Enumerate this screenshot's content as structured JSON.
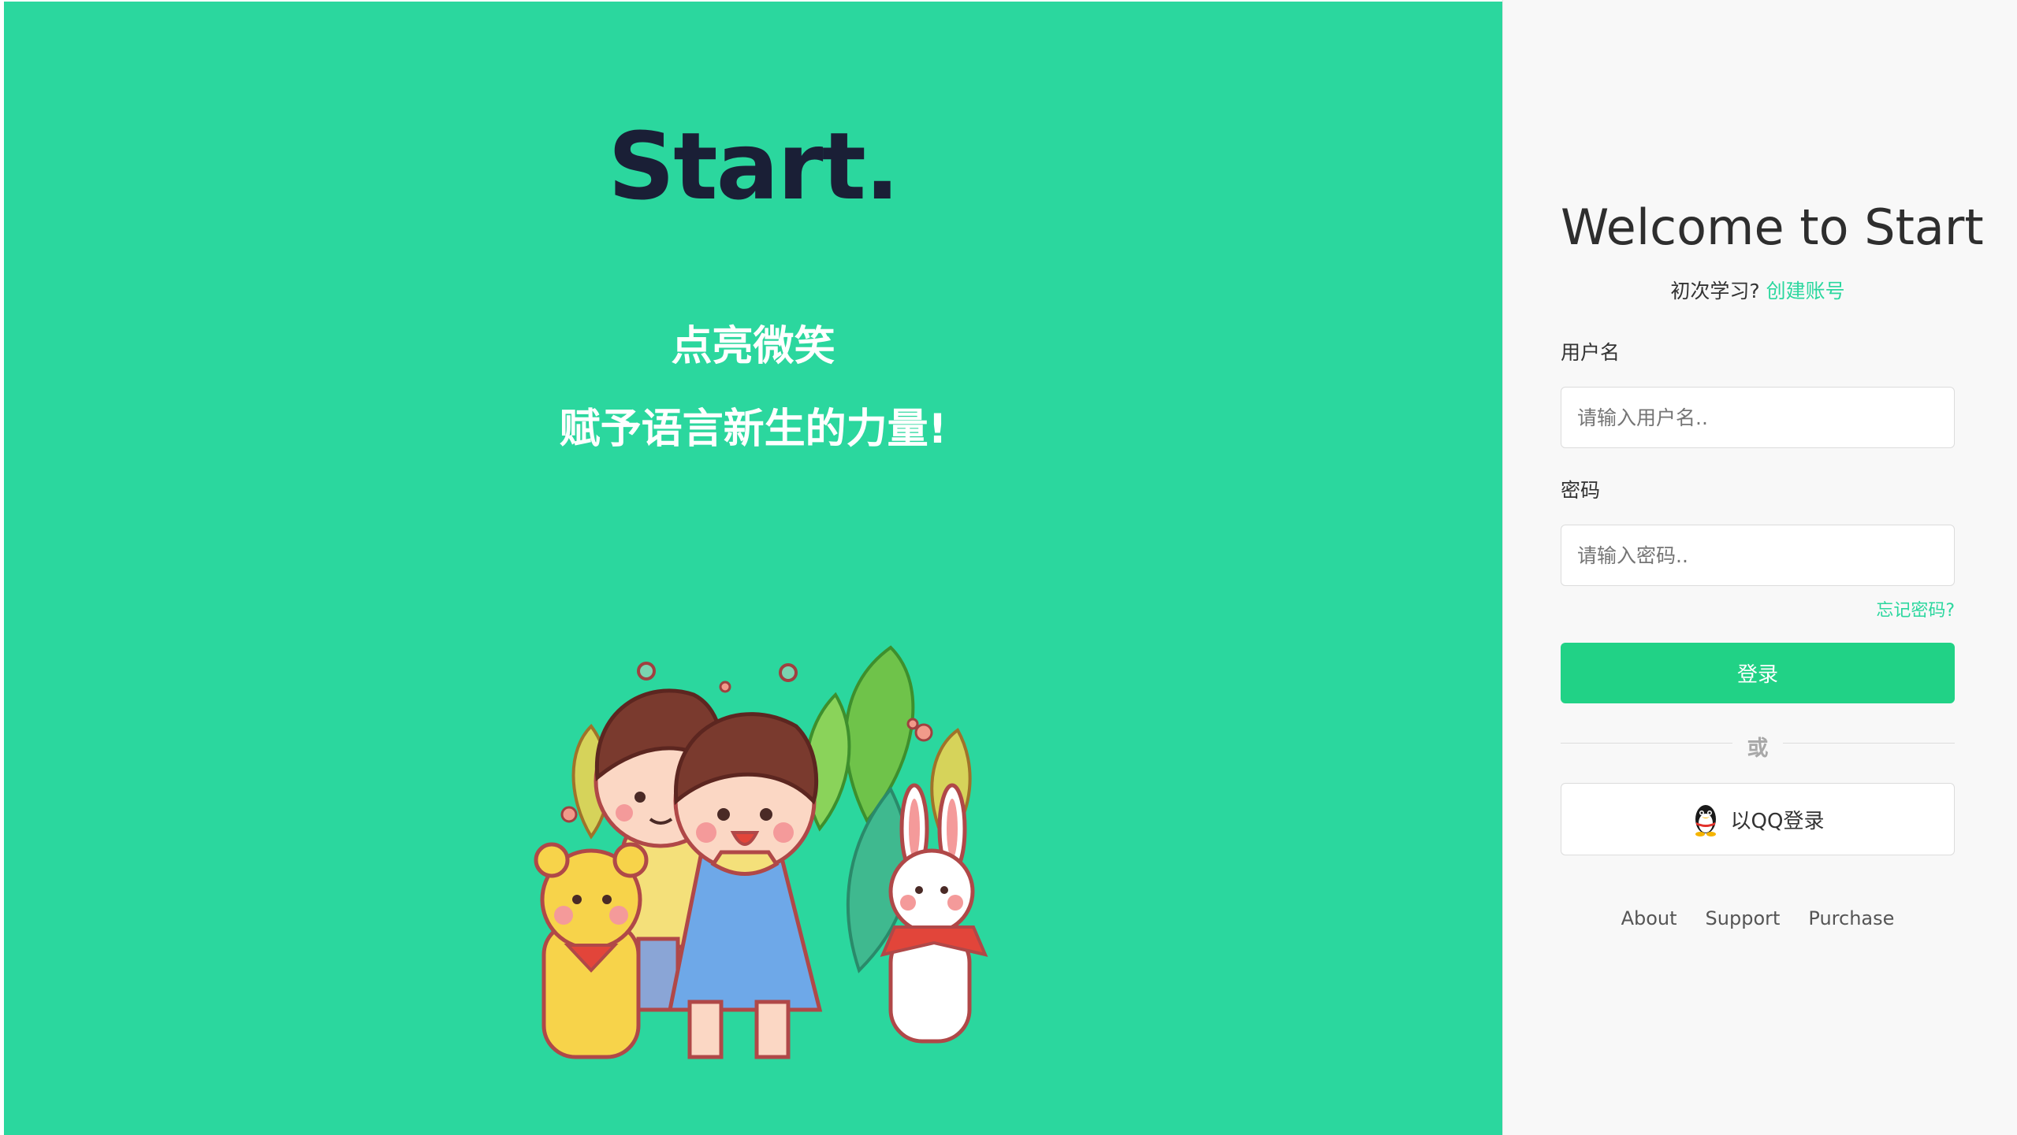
{
  "brand": {
    "logo_text": "Start.",
    "slogan_line1": "点亮微笑",
    "slogan_line2": "赋予语言新生的力量!"
  },
  "login": {
    "title": "Welcome to Start",
    "signup_prompt": "初次学习?",
    "signup_link": "创建账号",
    "username_label": "用户名",
    "username_placeholder": "请输入用户名..",
    "password_label": "密码",
    "password_placeholder": "请输入密码..",
    "forgot_password": "忘记密码?",
    "login_button": "登录",
    "divider_text": "或",
    "qq_login": "以QQ登录"
  },
  "footer": {
    "links": [
      "About",
      "Support",
      "Purchase"
    ]
  },
  "icons": {
    "qq": "qq-penguin-icon",
    "illustration": "kids-and-animals-illustration"
  },
  "colors": {
    "brand_green": "#2bd79e",
    "button_green": "#21d286",
    "logo_dark": "#1a1f36",
    "panel_bg": "#f8f8f8"
  }
}
